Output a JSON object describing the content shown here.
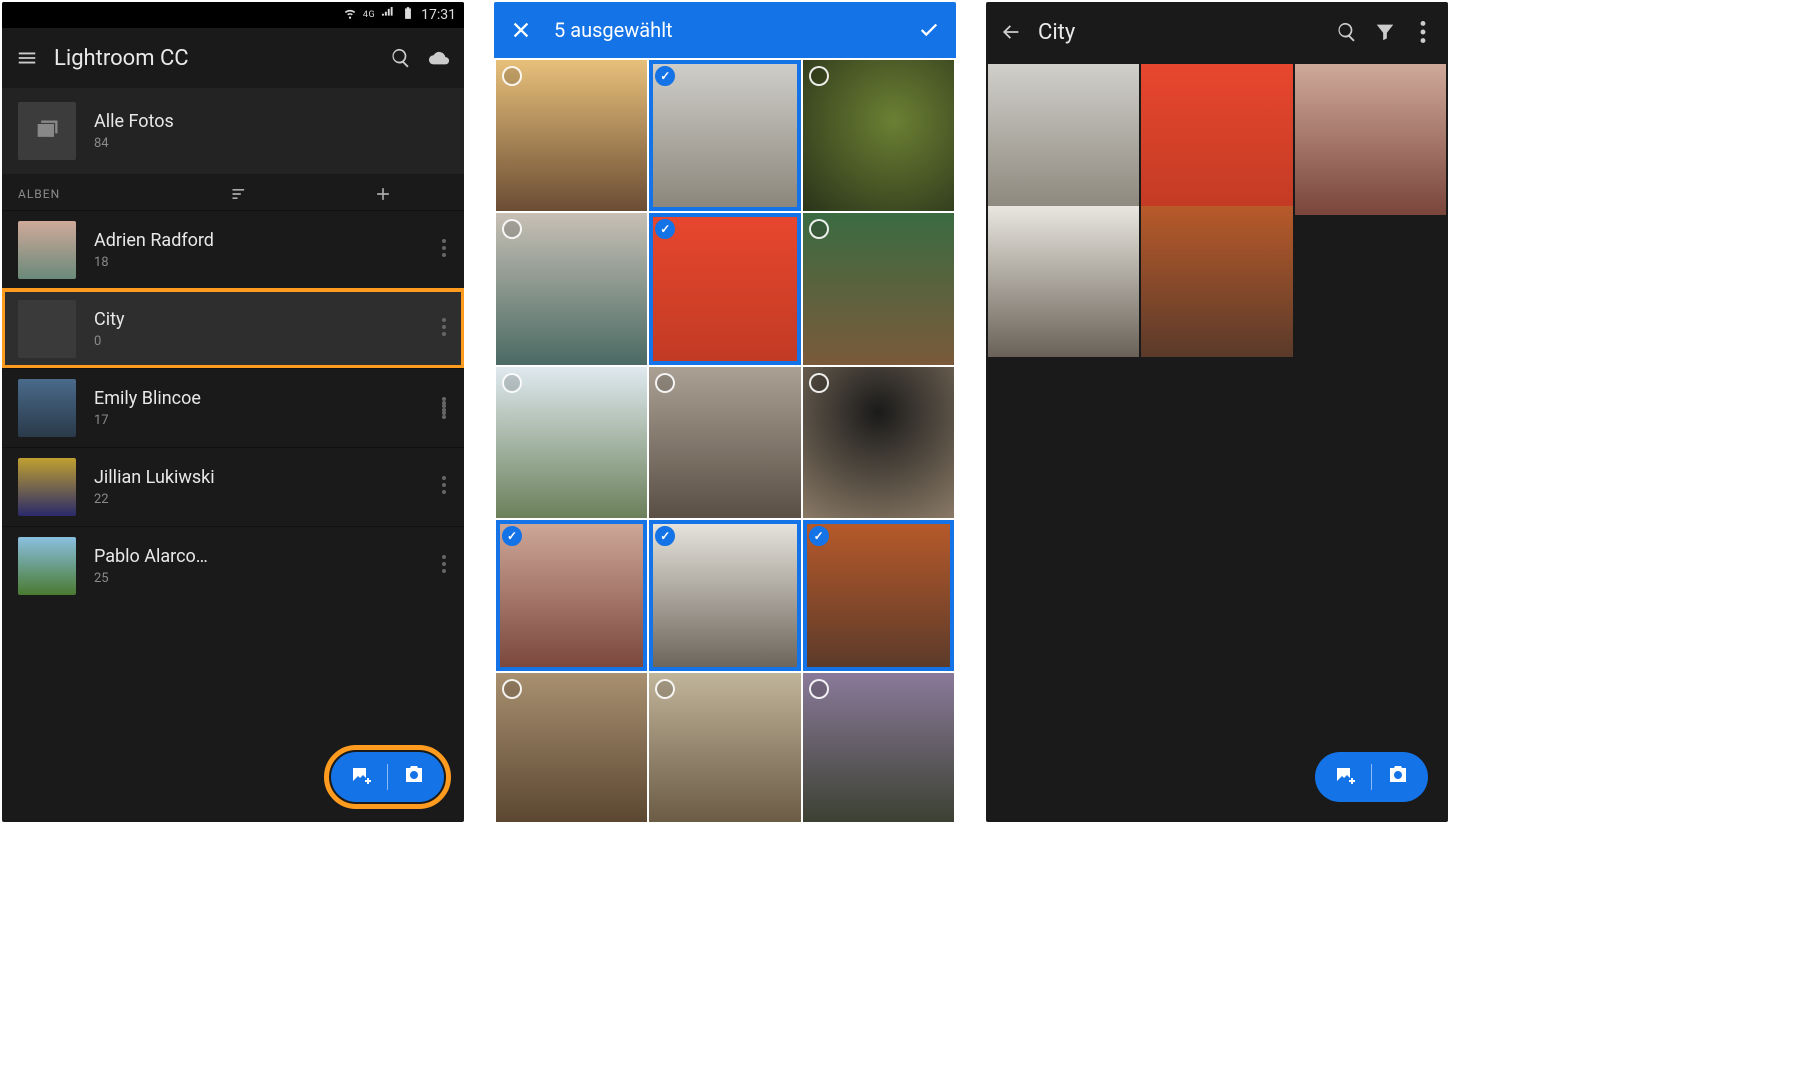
{
  "statusbar": {
    "network_label": "4G",
    "time": "17:31"
  },
  "phone1": {
    "app_title": "Lightroom CC",
    "all_photos": {
      "label": "Alle Fotos",
      "count": "84"
    },
    "section_label": "ALBEN",
    "albums": [
      {
        "name": "Adrien Radford",
        "count": "18",
        "highlighted": false
      },
      {
        "name": "City",
        "count": "0",
        "highlighted": true
      },
      {
        "name": "Emily Blincoe",
        "count": "17",
        "highlighted": false
      },
      {
        "name": "Jillian Lukiwski",
        "count": "22",
        "highlighted": false
      },
      {
        "name": "Pablo Alarco…",
        "count": "25",
        "highlighted": false
      }
    ],
    "fab_highlighted": true
  },
  "phone2": {
    "selection_title": "5 ausgewählt",
    "grid": [
      {
        "style": "ph-jump",
        "selected": false
      },
      {
        "style": "ph-tv",
        "selected": true
      },
      {
        "style": "ph-food",
        "selected": false
      },
      {
        "style": "ph-ok",
        "selected": false
      },
      {
        "style": "ph-wall",
        "selected": true
      },
      {
        "style": "ph-shop",
        "selected": false
      },
      {
        "style": "ph-cotton",
        "selected": false
      },
      {
        "style": "ph-frame",
        "selected": false
      },
      {
        "style": "ph-coffee",
        "selected": false
      },
      {
        "style": "ph-door",
        "selected": true
      },
      {
        "style": "ph-street",
        "selected": true
      },
      {
        "style": "ph-autumn",
        "selected": true
      },
      {
        "style": "ph-books",
        "selected": false
      },
      {
        "style": "ph-room",
        "selected": false
      },
      {
        "style": "ph-flowers",
        "selected": false
      }
    ]
  },
  "phone3": {
    "album_title": "City",
    "grid": [
      {
        "style": "ph-tv"
      },
      {
        "style": "ph-wall"
      },
      {
        "style": "ph-door"
      },
      {
        "style": "ph-street"
      },
      {
        "style": "ph-autumn"
      }
    ]
  }
}
